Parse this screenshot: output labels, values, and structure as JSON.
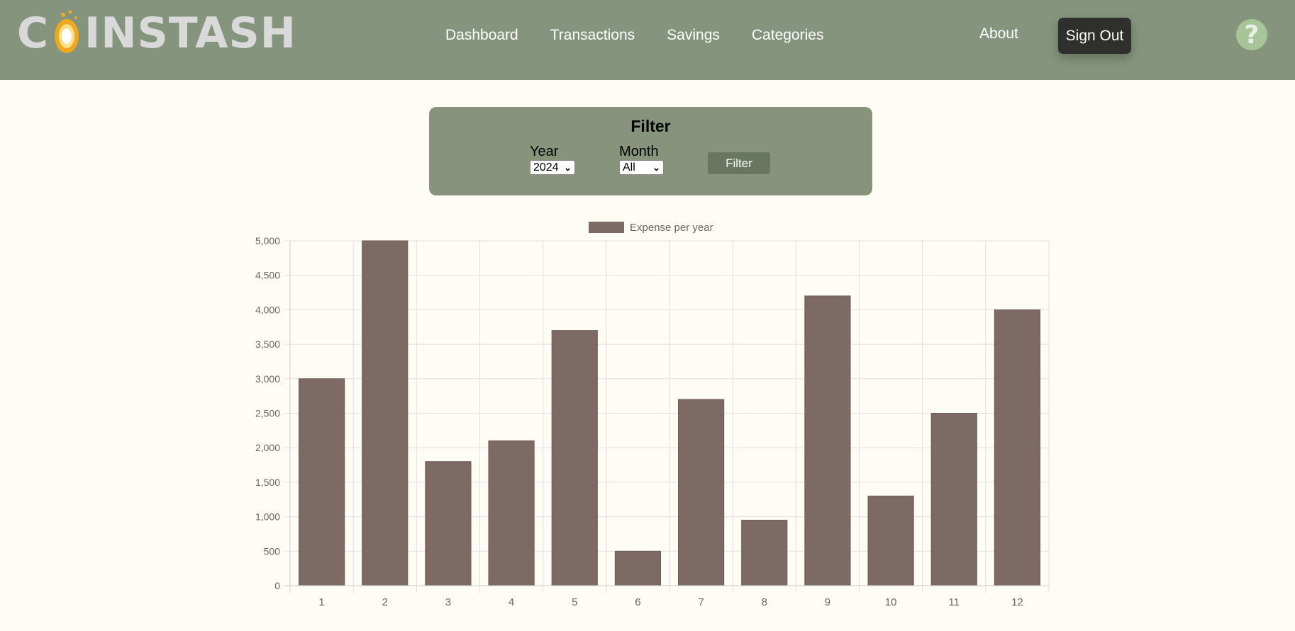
{
  "brand": {
    "logo_left": "C",
    "logo_right": "INSTASH"
  },
  "nav": {
    "links": [
      "Dashboard",
      "Transactions",
      "Savings",
      "Categories"
    ],
    "about": "About",
    "sign_out": "Sign Out",
    "help": "?"
  },
  "filter": {
    "title": "Filter",
    "year_label": "Year",
    "year_value": "2024",
    "month_label": "Month",
    "month_value": "All",
    "button": "Filter"
  },
  "colors": {
    "navbar": "#85957d",
    "bar": "#7e6a64",
    "panel": "#88937b",
    "background": "#fffcf6"
  },
  "chart_data": {
    "type": "bar",
    "categories": [
      "1",
      "2",
      "3",
      "4",
      "5",
      "6",
      "7",
      "8",
      "9",
      "10",
      "11",
      "12"
    ],
    "series": [
      {
        "name": "Expense per year",
        "values": [
          3000,
          5000,
          1800,
          2100,
          3700,
          500,
          2700,
          950,
          4200,
          1300,
          2500,
          4000
        ]
      }
    ],
    "ylim": [
      0,
      5000
    ],
    "yticks": [
      "0",
      "500",
      "1,000",
      "1,500",
      "2,000",
      "2,500",
      "3,000",
      "3,500",
      "4,000",
      "4,500",
      "5,000"
    ],
    "grid": true,
    "legend": "top-center"
  }
}
